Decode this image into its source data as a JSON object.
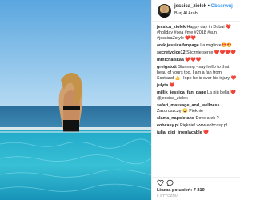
{
  "header": {
    "username": "jessica_ziolek",
    "separator": "•",
    "follow_label": "Obserwuj",
    "location": "Burj Al Arab"
  },
  "comments": [
    {
      "user": "jessica_ziolek",
      "text": "Happy day in Dubai ❤️ #holiday #sea #me #2018 #sun #jessicaZstyle ❤️❤️"
    },
    {
      "user": "arek.jessica.fanpage",
      "text": "La migliore😍😍"
    },
    {
      "user": "secretvoice12",
      "text": "Ślicznie serce ❤️❤️❤️❤️"
    },
    {
      "user": "mmichalskaa",
      "text": "❤️❤️❤️"
    },
    {
      "user": "greigstott",
      "text": "Stunning - say hello to that beau of yours too, I am a fan from Scotland 👍 Hope he is over his injury ❤️"
    },
    {
      "user": "julyta",
      "text": "❤️"
    },
    {
      "user": "millik_jessica_fan_page",
      "text": "La più bella ❤️ @jessica_ziolek"
    },
    {
      "user": "safari_massage_and_wellness",
      "text": "Zazdroszczę 😀 Pięknie"
    },
    {
      "user": "slama_napoletano",
      "text": "Dove arek ?"
    },
    {
      "user": "eobcasy.pl",
      "text": "Pięknie! www.eobcasy.pl"
    },
    {
      "user": "julia_qiqi_irreplacable",
      "text": "❤️"
    }
  ],
  "footer": {
    "likes_label": "Liczba polubień:",
    "likes_count": "7 210",
    "date": "6 STYCZNIA"
  },
  "icons": [
    "heart-icon",
    "comment-icon"
  ],
  "colors": {
    "link_blue": "#3897f0",
    "text": "#262626",
    "sky": "#7dbbe6",
    "pool": "#2fb5cf"
  }
}
